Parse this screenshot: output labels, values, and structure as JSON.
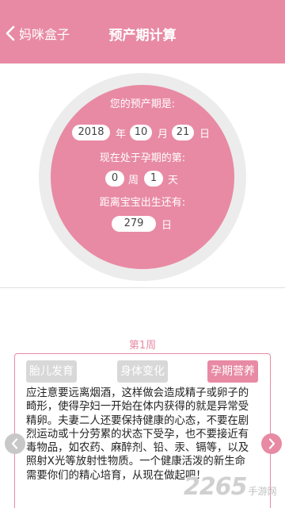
{
  "header": {
    "back_label": "妈咪盒子",
    "title": "预产期计算"
  },
  "calculator": {
    "due_date_label": "您的预产期是:",
    "year": "2018",
    "year_unit": "年",
    "month": "10",
    "month_unit": "月",
    "day": "21",
    "day_unit": "日",
    "stage_label": "现在处于孕期的第:",
    "weeks": "0",
    "weeks_unit": "周",
    "days": "1",
    "days_unit": "天",
    "remaining_label": "距离宝宝出生还有:",
    "remaining_days": "279",
    "remaining_unit": "日"
  },
  "week": {
    "title": "第1周",
    "tabs": [
      {
        "label": "胎儿发育",
        "active": false
      },
      {
        "label": "身体变化",
        "active": false
      },
      {
        "label": "孕期营养",
        "active": true
      }
    ],
    "content_lines": [
      "应注意要远离烟酒，这样做会造成精子或卵子的",
      "畸形，使得孕妇一开始在体内获得的就是异常受",
      "精卵。夫妻二人还要保持健康的心态，不要在剧",
      "烈运动或十分劳累的状态下受孕，也不要接近有",
      "毒物品，如农药、麻醉剂、铅、汞、镉等，以及",
      "照射X光等放射性物质。一个健康活泼的新生命",
      "需要你们的精心培育，从现在做起吧！"
    ]
  },
  "watermark": {
    "number": "2265",
    "text": "手游网"
  },
  "colors": {
    "accent": "#e88aa4",
    "ring": "#ececec",
    "tab_inactive": "#d8d8d8"
  }
}
